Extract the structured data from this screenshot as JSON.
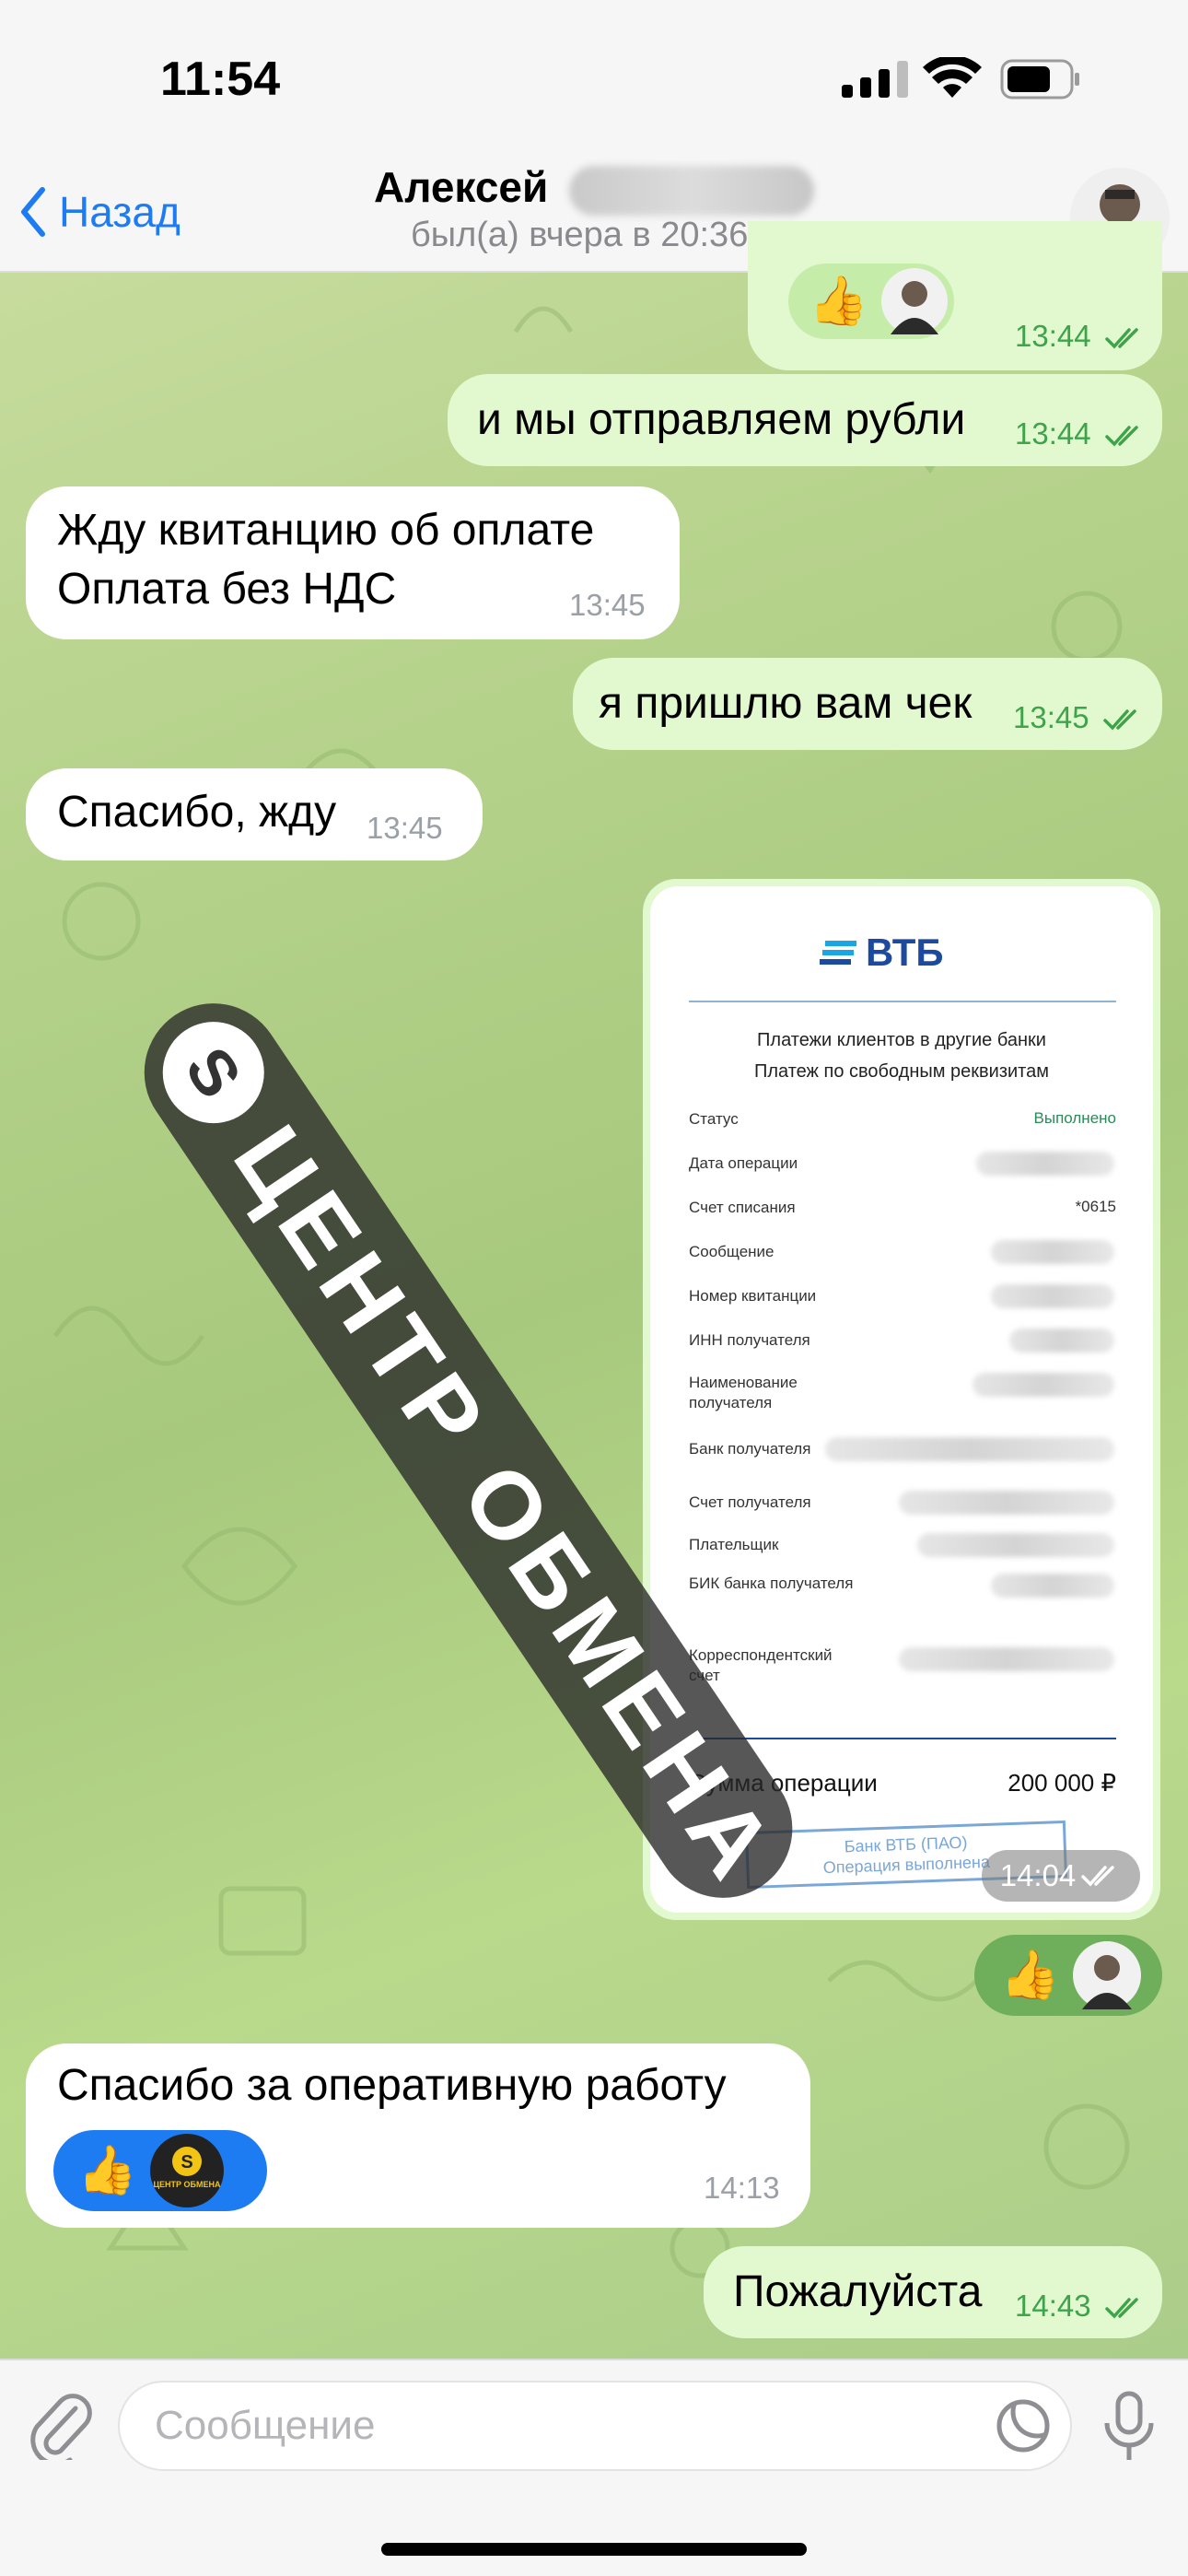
{
  "status_bar": {
    "time": "11:54"
  },
  "header": {
    "back_label": "Назад",
    "contact_name": "Алексей",
    "last_seen": "был(а) вчера в 20:36"
  },
  "messages": [
    {
      "side": "out",
      "type": "reaction",
      "reaction": "👍",
      "time": "13:44"
    },
    {
      "side": "out",
      "text": "и мы отправляем рубли",
      "time": "13:44"
    },
    {
      "side": "in",
      "lines": [
        "Жду квитанцию об оплате",
        "Оплата без НДС"
      ],
      "time": "13:45"
    },
    {
      "side": "out",
      "text": "я пришлю вам чек",
      "time": "13:45"
    },
    {
      "side": "in",
      "text": "Спасибо, жду",
      "time": "13:45"
    },
    {
      "side": "out",
      "type": "receipt",
      "time": "14:04"
    },
    {
      "side": "out",
      "type": "reaction",
      "reaction": "👍"
    },
    {
      "side": "in",
      "text": "Спасибо за оперативную работу",
      "reaction": "👍",
      "time": "14:13"
    },
    {
      "side": "out",
      "text": "Пожалуйста",
      "time": "14:43"
    }
  ],
  "receipt": {
    "bank": "ВТБ",
    "heading1": "Платежи клиентов в другие банки",
    "heading2": "Платеж по свободным реквизитам",
    "rows": [
      {
        "label": "Статус",
        "value": "Выполнено"
      },
      {
        "label": "Дата операции",
        "value": ""
      },
      {
        "label": "Счет списания",
        "value": "*0615"
      },
      {
        "label": "Сообщение",
        "value": ""
      },
      {
        "label": "Номер квитанции",
        "value": ""
      },
      {
        "label": "ИНН получателя",
        "value": ""
      },
      {
        "label": "Наименование получателя",
        "value": ""
      },
      {
        "label": "Банк получателя",
        "value": ""
      },
      {
        "label": "Счет получателя",
        "value": ""
      },
      {
        "label": "Плательщик",
        "value": ""
      },
      {
        "label": "БИК банка получателя",
        "value": ""
      },
      {
        "label": "Корреспондентский счет",
        "value": ""
      }
    ],
    "sum_label": "Сумма операции",
    "sum_value": "200 000 ₽",
    "stamp_line1": "Банк ВТБ (ПАО)",
    "stamp_line2": "Операция выполнена",
    "status_color": "#2b8a5a"
  },
  "watermark": {
    "text": "ЦЕНТР ОБМЕНА"
  },
  "reaction_avatar_label": "ЦЕНТР ОБМЕНА",
  "input": {
    "placeholder": "Сообщение"
  },
  "colors": {
    "accent": "#1e7cf2",
    "out_bubble": "#e2f9cf",
    "in_bubble": "#ffffff",
    "out_time": "#3ea34a"
  }
}
